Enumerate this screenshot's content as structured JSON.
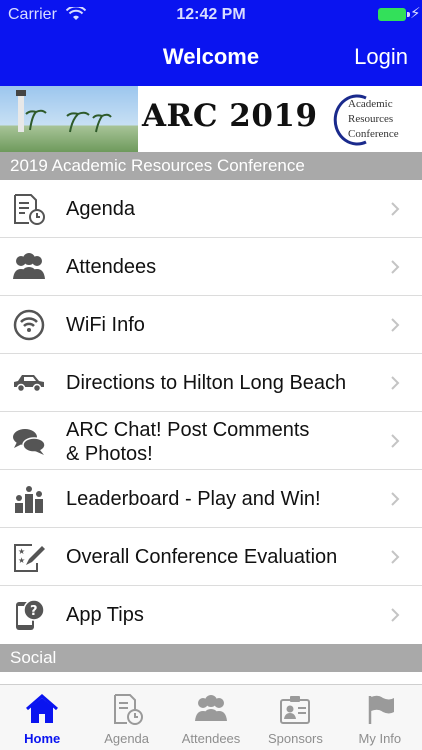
{
  "status_bar": {
    "carrier": "Carrier",
    "time": "12:42 PM"
  },
  "nav": {
    "title": "Welcome",
    "login": "Login"
  },
  "banner": {
    "title": "ARC 2019",
    "logo_lines": [
      "Academic",
      "Resources",
      "Conference"
    ]
  },
  "conference_header": "2019 Academic Resources Conference",
  "menu": [
    {
      "label": "Agenda",
      "icon": "agenda-icon"
    },
    {
      "label": "Attendees",
      "icon": "attendees-icon"
    },
    {
      "label": "WiFi Info",
      "icon": "wifi-icon"
    },
    {
      "label": "Directions to Hilton Long Beach",
      "icon": "car-icon"
    },
    {
      "label_line1": "ARC Chat! Post Comments",
      "label_line2": "& Photos!",
      "icon": "chat-icon"
    },
    {
      "label": "Leaderboard - Play and Win!",
      "icon": "leaderboard-icon"
    },
    {
      "label": "Overall Conference Evaluation",
      "icon": "evaluation-icon"
    },
    {
      "label": "App Tips",
      "icon": "app-tips-icon"
    }
  ],
  "social_header": "Social",
  "tabs": [
    {
      "label": "Home",
      "icon": "home-icon",
      "active": true
    },
    {
      "label": "Agenda",
      "icon": "agenda-icon"
    },
    {
      "label": "Attendees",
      "icon": "attendees-icon"
    },
    {
      "label": "Sponsors",
      "icon": "sponsors-icon"
    },
    {
      "label": "My Info",
      "icon": "flag-icon"
    }
  ],
  "colors": {
    "nav_blue": "#0a14f0",
    "header_gray": "#a9a9a9",
    "battery_green": "#33e05a"
  }
}
